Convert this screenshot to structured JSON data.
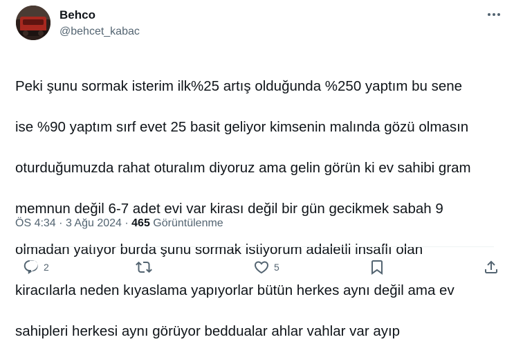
{
  "author": {
    "display_name": "Behco",
    "handle": "@behcet_kabac"
  },
  "tweet": {
    "lines": [
      "Peki şunu sormak isterim ilk%25 artış olduğunda %250 yaptım bu sene",
      "ise %90 yaptım sırf evet 25 basit geliyor kimsenin malında gözü olmasın",
      "oturduğumuzda rahat oturalım diyoruz ama gelin görün ki ev sahibi gram",
      "memnun değil 6-7 adet evi var kirası değil bir gün gecikmek sabah 9",
      "olmadan yatıyor burda şunu sormak istiyorum adaletli insaflı olan",
      "kiracılarla neden kıyaslama yapıyorlar bütün herkes aynı değil ama ev",
      "sahipleri herkesi aynı görüyor beddualar ahlar vahlar var ayıp"
    ],
    "time": "ÖS 4:34",
    "separator": "·",
    "date": "3 Ağu 2024",
    "views_count": "465",
    "views_label": "Görüntülenme"
  },
  "actions": {
    "reply_count": "2",
    "retweet_count": "",
    "like_count": "5"
  },
  "icons": {
    "more": "more-horizontal-icon",
    "reply": "reply-icon",
    "retweet": "retweet-icon",
    "like": "heart-icon",
    "bookmark": "bookmark-icon",
    "share": "share-icon"
  },
  "colors": {
    "text": "#0f1419",
    "secondary": "#536471",
    "divider": "#eff3f4"
  }
}
